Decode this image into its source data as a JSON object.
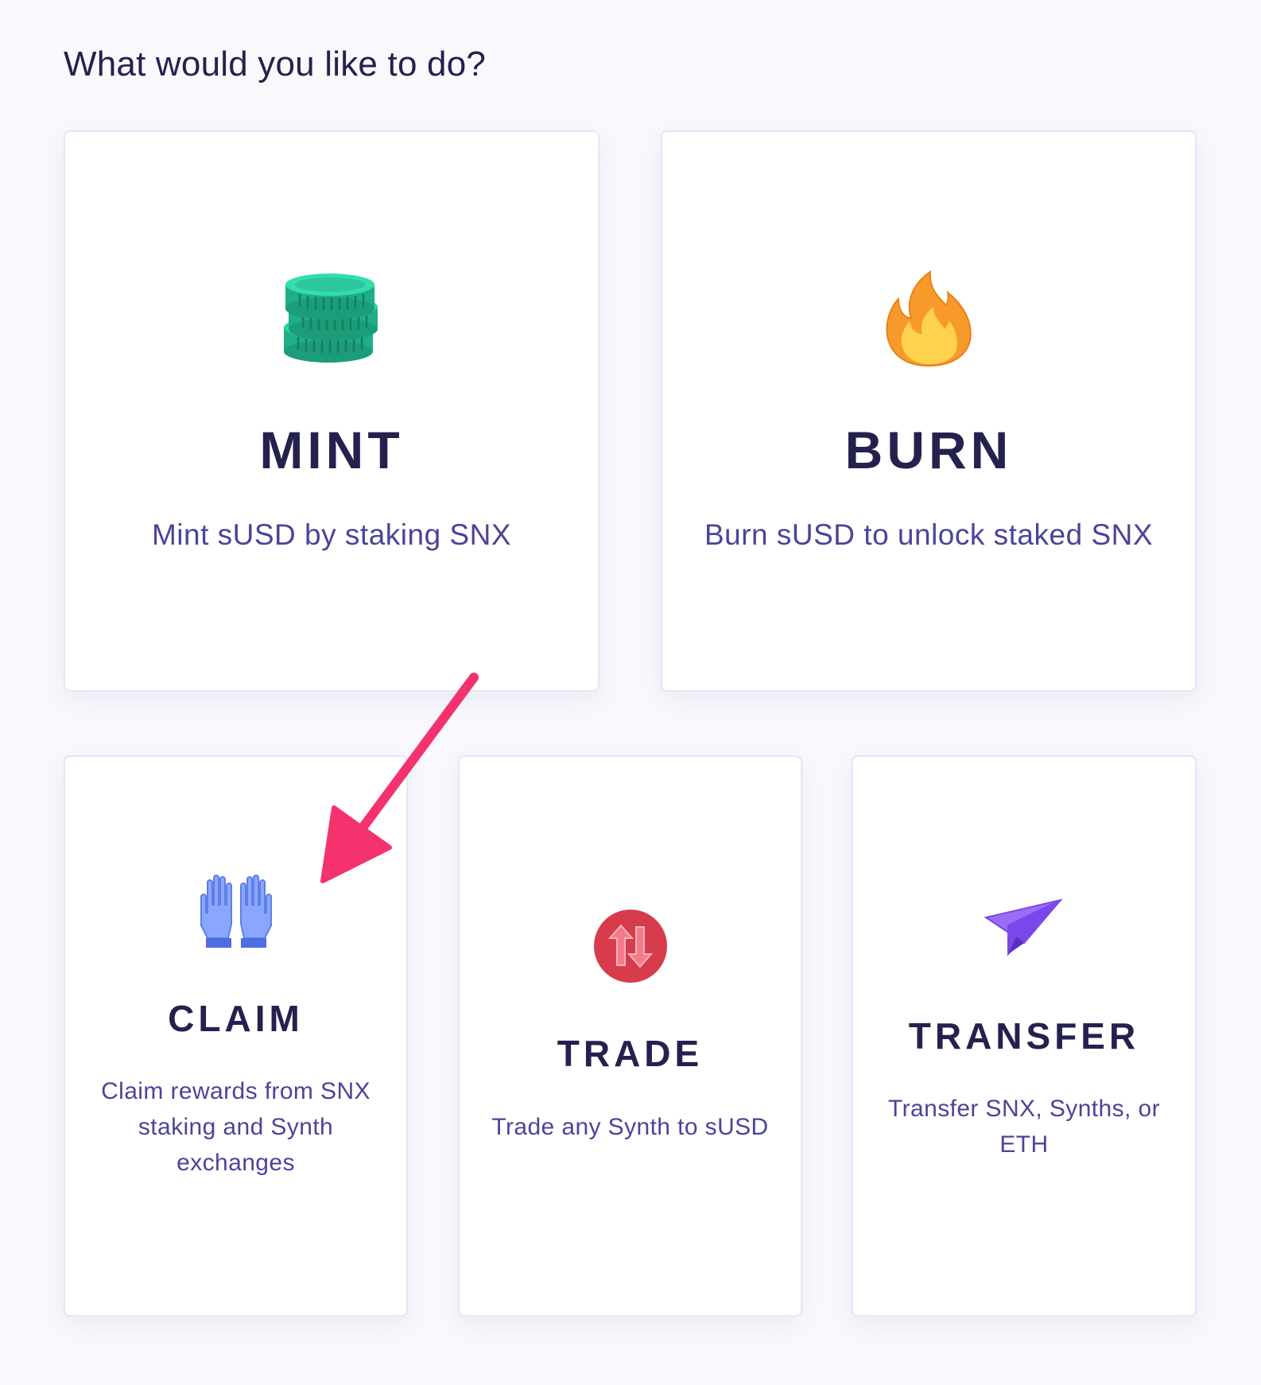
{
  "heading": "What would you like to do?",
  "actions": {
    "mint": {
      "title": "MINT",
      "description": "Mint sUSD by staking SNX",
      "icon": "coins-stack-icon"
    },
    "burn": {
      "title": "BURN",
      "description": "Burn sUSD to unlock staked SNX",
      "icon": "fire-icon"
    },
    "claim": {
      "title": "CLAIM",
      "description": "Claim rewards from SNX staking and Synth exchanges",
      "icon": "open-hands-icon"
    },
    "trade": {
      "title": "TRADE",
      "description": "Trade any Synth to sUSD",
      "icon": "up-down-arrows-icon"
    },
    "transfer": {
      "title": "TRANSFER",
      "description": "Transfer SNX, Synths, or ETH",
      "icon": "paper-plane-icon"
    }
  },
  "colors": {
    "heading": "#25214f",
    "title": "#25214f",
    "description": "#4b4499",
    "annotation_arrow": "#f4326e"
  }
}
